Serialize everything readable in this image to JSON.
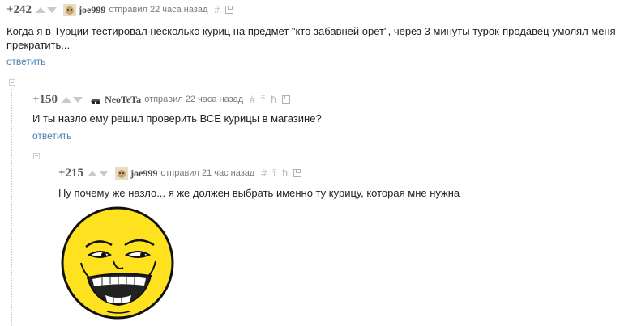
{
  "comments": [
    {
      "rating": "+242",
      "author": "joe999",
      "meta": "отправил 22 часа назад",
      "tool_hash": "#",
      "text_line1": "Когда я в Турции тестировал несколько куриц на предмет \"кто забавней орет\", через 3 минуты турок-продавец умолял меня",
      "text_line2": "прекратить...",
      "reply": "ответить",
      "avatar_icon": "dog-avatar-icon"
    },
    {
      "rating": "+150",
      "author": "NeoTeTa",
      "meta": "отправил 22 часа назад",
      "tool_hash": "#",
      "tool_up": "⤒",
      "tool_link": "ħ",
      "text": "И ты назло ему решил проверить ВСЕ курицы в магазине?",
      "reply": "ответить",
      "avatar_icon": "car-avatar-icon"
    },
    {
      "rating": "+215",
      "author": "joe999",
      "meta": "отправил 21 час назад",
      "tool_hash": "#",
      "tool_up": "⤒",
      "tool_link": "ħ",
      "text": "Ну почему же назло... я же должен выбрать именно ту курицу, которая мне нужна",
      "avatar_icon": "dog-avatar-icon",
      "image_icon": "troll-smiley-face-icon"
    }
  ],
  "colors": {
    "link": "#4d7fb0",
    "smiley": "#ffe21f"
  }
}
